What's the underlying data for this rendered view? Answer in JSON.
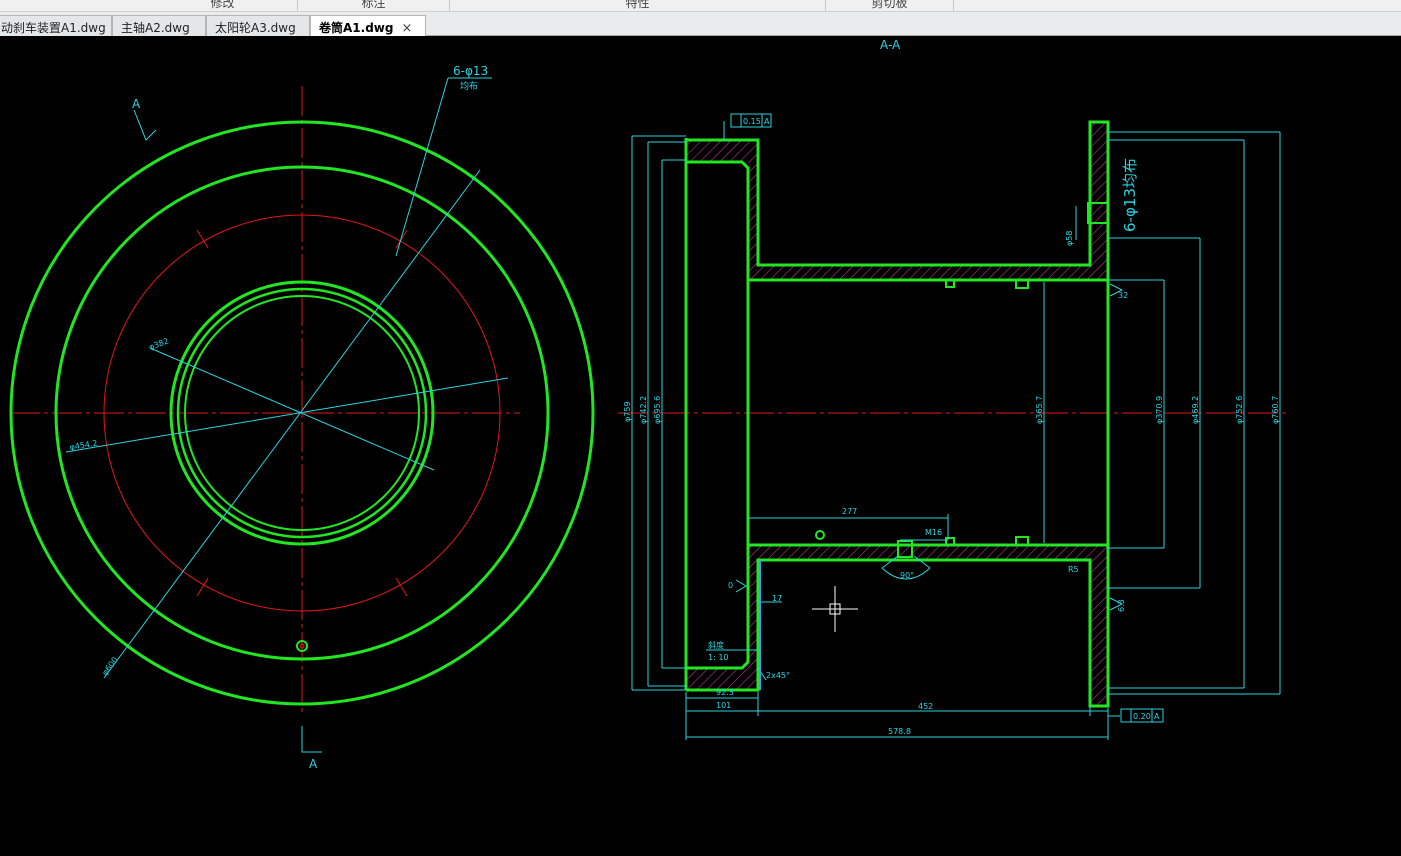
{
  "ribbon": {
    "groups": [
      "修改",
      "标注",
      "特性",
      "剪切板"
    ]
  },
  "tabs": [
    {
      "label": "动刹车装置A1.dwg",
      "active": false
    },
    {
      "label": "主轴A2.dwg",
      "active": false
    },
    {
      "label": "太阳轮A3.dwg",
      "active": false
    },
    {
      "label": "卷筒A1.dwg",
      "active": true
    }
  ],
  "tab_close_glyph": "×",
  "drawing": {
    "colors": {
      "background": "#000000",
      "outline": "#22e622",
      "center_line": "#e01818",
      "dimension": "#2ad4e0",
      "hatch": "#c0309a",
      "crosshair": "#ffffff"
    },
    "front_view": {
      "section_mark_top": "A",
      "section_mark_bottom": "A",
      "hole_note": "6-φ13",
      "hole_note_sub": "均布",
      "dim_d382": "φ382",
      "dim_d4542": "φ454.2",
      "dim_d600": "φ600"
    },
    "section_view": {
      "title": "A-A",
      "tol_left": "0.15",
      "tol_left_ref": "A",
      "tol_right": "0.20",
      "tol_right_ref": "A",
      "holes_note": "6-φ13均布",
      "dim_d58": "φ58",
      "dim_277": "277",
      "dim_m16": "M16",
      "dim_90": "90°",
      "dim_17": "17",
      "slope_label": "斜度",
      "slope_value": "1: 10",
      "chamfer": "2x45°",
      "dim_923": "92.3",
      "dim_101": "101",
      "dim_452": "452",
      "dim_5788": "578.8",
      "left_diams": [
        "φ759",
        "φ742.2",
        "φ695.6"
      ],
      "inner_bore": "φ365.7",
      "right_diams": [
        "φ370.9",
        "φ469.2",
        "φ752.6",
        "φ760.7"
      ],
      "small_note_r": "R5",
      "small_note_32": "32",
      "small_note_63": "6.3",
      "mark_0": "0"
    }
  }
}
